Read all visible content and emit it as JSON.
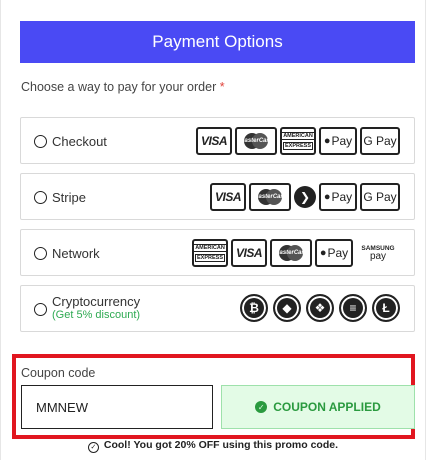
{
  "header": {
    "title": "Payment Options"
  },
  "prompt": {
    "text": "Choose a way to pay for your order",
    "required_mark": "*"
  },
  "options": [
    {
      "label": "Checkout",
      "icons": [
        "VISA",
        "MasterCard",
        "AMERICAN EXPRESS",
        "Pay",
        "G Pay"
      ]
    },
    {
      "label": "Stripe",
      "icons": [
        "VISA",
        "MasterCard",
        "arrow",
        "Pay",
        "G Pay"
      ]
    },
    {
      "label": "Network",
      "icons": [
        "AMERICAN EXPRESS",
        "VISA",
        "MasterCard",
        "Pay",
        "SAMSUNG pay"
      ]
    },
    {
      "label": "Cryptocurrency",
      "sublabel": "(Get 5% discount)",
      "icons": [
        "bitcoin-icon",
        "ethereum-icon",
        "bnb-icon",
        "stablecoin-icon",
        "litecoin-icon"
      ]
    }
  ],
  "card_text": {
    "visa": "VISA",
    "mastercard": "MasterCard",
    "amex_line1": "AMERICAN",
    "amex_line2": "EXPRESS",
    "apple_pay": "Pay",
    "google_pay": "G Pay",
    "samsung_line1": "SAMSUNG",
    "samsung_line2": "pay"
  },
  "coupon": {
    "label": "Coupon code",
    "value": "MMNEW",
    "button_label": "COUPON APPLIED",
    "success_message": "Cool! You got 20% OFF using this promo code."
  },
  "colors": {
    "header_bg": "#4a4af4",
    "highlight_border": "#e1161f",
    "success_green": "#2a9a3f",
    "success_bg": "#e3fbe6"
  }
}
